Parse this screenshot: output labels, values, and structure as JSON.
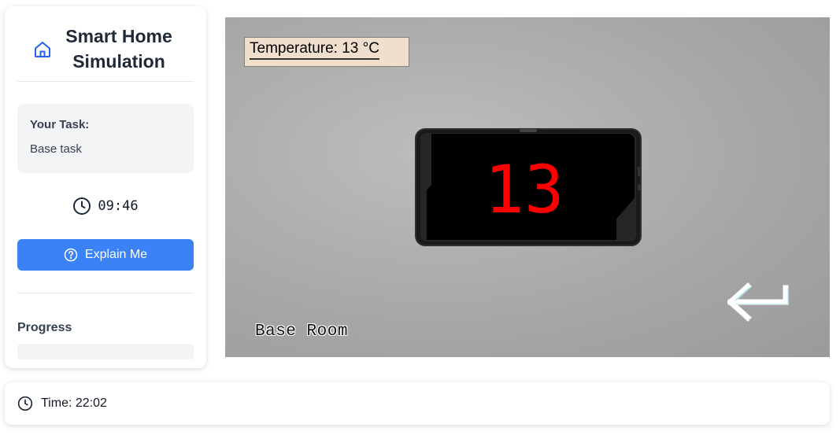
{
  "sidebar": {
    "brand": {
      "title": "Smart Home Simulation",
      "icon": "home-icon",
      "icon_color": "#2563eb"
    },
    "task": {
      "heading": "Your Task:",
      "text": "Base task"
    },
    "timer": {
      "icon": "clock-icon",
      "value": "09:46"
    },
    "explain_button": {
      "label": "Explain Me",
      "icon": "help-circle-icon",
      "color": "#3b82f6"
    },
    "progress": {
      "label": "Progress"
    }
  },
  "scene": {
    "temperature_label": "Temperature: 13 °C",
    "thermostat_display": "13",
    "display_color": "#ff0000",
    "room_name": "Base Room",
    "back_icon": "return-arrow-icon"
  },
  "footer": {
    "icon": "clock-icon",
    "time_text": "Time: 22:02"
  }
}
